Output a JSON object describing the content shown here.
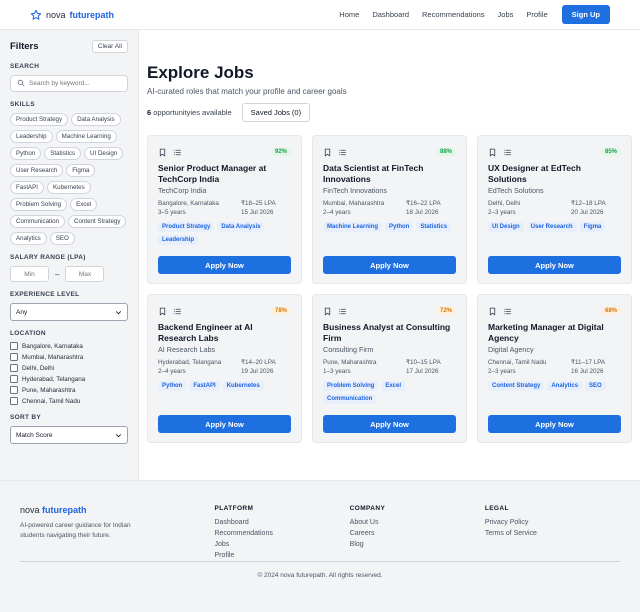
{
  "header": {
    "brand_nova": "nova",
    "brand_fp": "futurepath",
    "nav": [
      "Home",
      "Dashboard",
      "Recommendations",
      "Jobs",
      "Profile"
    ],
    "signup": "Sign Up"
  },
  "sidebar": {
    "title": "Filters",
    "clear": "Clear All",
    "search_label": "SEARCH",
    "search_placeholder": "Search by keyword...",
    "skills_label": "SKILLS",
    "skills": [
      "Product Strategy",
      "Data Analysis",
      "Leadership",
      "Machine Learning",
      "Python",
      "Statistics",
      "UI Design",
      "User Research",
      "Figma",
      "FastAPI",
      "Kubernetes",
      "Problem Solving",
      "Excel",
      "Communication",
      "Content Strategy",
      "Analytics",
      "SEO"
    ],
    "salary_label": "SALARY RANGE (LPA)",
    "salary_min": "Min",
    "salary_dash": "–",
    "salary_max": "Max",
    "experience_label": "EXPERIENCE LEVEL",
    "experience_value": "Any",
    "location_label": "LOCATION",
    "locations": [
      "Bangalore, Karnataka",
      "Mumbai, Maharashtra",
      "Delhi, Delhi",
      "Hyderabad, Telangana",
      "Pune, Maharashtra",
      "Chennai, Tamil Nadu"
    ],
    "sort_label": "SORT BY",
    "sort_value": "Match Score"
  },
  "main": {
    "title": "Explore Jobs",
    "subtitle": "AI-curated roles that match your profile and career goals",
    "count": "6",
    "count_suffix": " opportunityies available",
    "saved": "Saved Jobs (0)",
    "apply_label": "Apply Now",
    "jobs": [
      {
        "match": "92%",
        "match_color": "green",
        "title": "Senior Product Manager at TechCorp India",
        "company": "TechCorp India",
        "location": "Bangalore, Karnataka",
        "salary": "₹18–25 LPA",
        "experience": "3–5 years",
        "date": "15 Jul 2026",
        "tags": [
          "Product Strategy",
          "Data Analysis",
          "Leadership"
        ]
      },
      {
        "match": "88%",
        "match_color": "green",
        "title": "Data Scientist at FinTech Innovations",
        "company": "FinTech Innovations",
        "location": "Mumbai, Maharashtra",
        "salary": "₹16–22 LPA",
        "experience": "2–4 years",
        "date": "18 Jul 2026",
        "tags": [
          "Machine Learning",
          "Python",
          "Statistics"
        ]
      },
      {
        "match": "85%",
        "match_color": "green",
        "title": "UX Designer at EdTech Solutions",
        "company": "EdTech Solutions",
        "location": "Delhi, Delhi",
        "salary": "₹12–18 LPA",
        "experience": "2–3 years",
        "date": "20 Jul 2026",
        "tags": [
          "UI Design",
          "User Research",
          "Figma"
        ]
      },
      {
        "match": "78%",
        "match_color": "orange",
        "title": "Backend Engineer at AI Research Labs",
        "company": "AI Research Labs",
        "location": "Hyderabad, Telangana",
        "salary": "₹14–20 LPA",
        "experience": "2–4 years",
        "date": "19 Jul 2026",
        "tags": [
          "Python",
          "FastAPI",
          "Kubernetes"
        ]
      },
      {
        "match": "72%",
        "match_color": "orange",
        "title": "Business Analyst at Consulting Firm",
        "company": "Consulting Firm",
        "location": "Pune, Maharashtra",
        "salary": "₹10–15 LPA",
        "experience": "1–3 years",
        "date": "17 Jul 2026",
        "tags": [
          "Problem Solving",
          "Excel",
          "Communication"
        ]
      },
      {
        "match": "68%",
        "match_color": "orange",
        "title": "Marketing Manager at Digital Agency",
        "company": "Digital Agency",
        "location": "Chennai, Tamil Nadu",
        "salary": "₹11–17 LPA",
        "experience": "2–3 years",
        "date": "16 Jul 2026",
        "tags": [
          "Content Strategy",
          "Analytics",
          "SEO"
        ]
      }
    ]
  },
  "footer": {
    "brand_nova": "nova",
    "brand_fp": "futurepath",
    "description": "AI-powered career guidance for Indian students navigating their future.",
    "platform_title": "PLATFORM",
    "platform_links": [
      "Dashboard",
      "Recommendations",
      "Jobs",
      "Profile"
    ],
    "company_title": "COMPANY",
    "company_links": [
      "About Us",
      "Careers",
      "Blog"
    ],
    "legal_title": "LEGAL",
    "legal_links": [
      "Privacy Policy",
      "Terms of Service"
    ],
    "copyright": "© 2024 nova futurepath. All rights reserved."
  },
  "colors": {
    "primary": "#1e6fe0",
    "match_green": "#16a34a",
    "match_orange": "#d97706"
  },
  "icons": [
    "star-logo-icon",
    "search-icon",
    "chevron-down-icon",
    "bookmark-icon",
    "list-icon"
  ]
}
